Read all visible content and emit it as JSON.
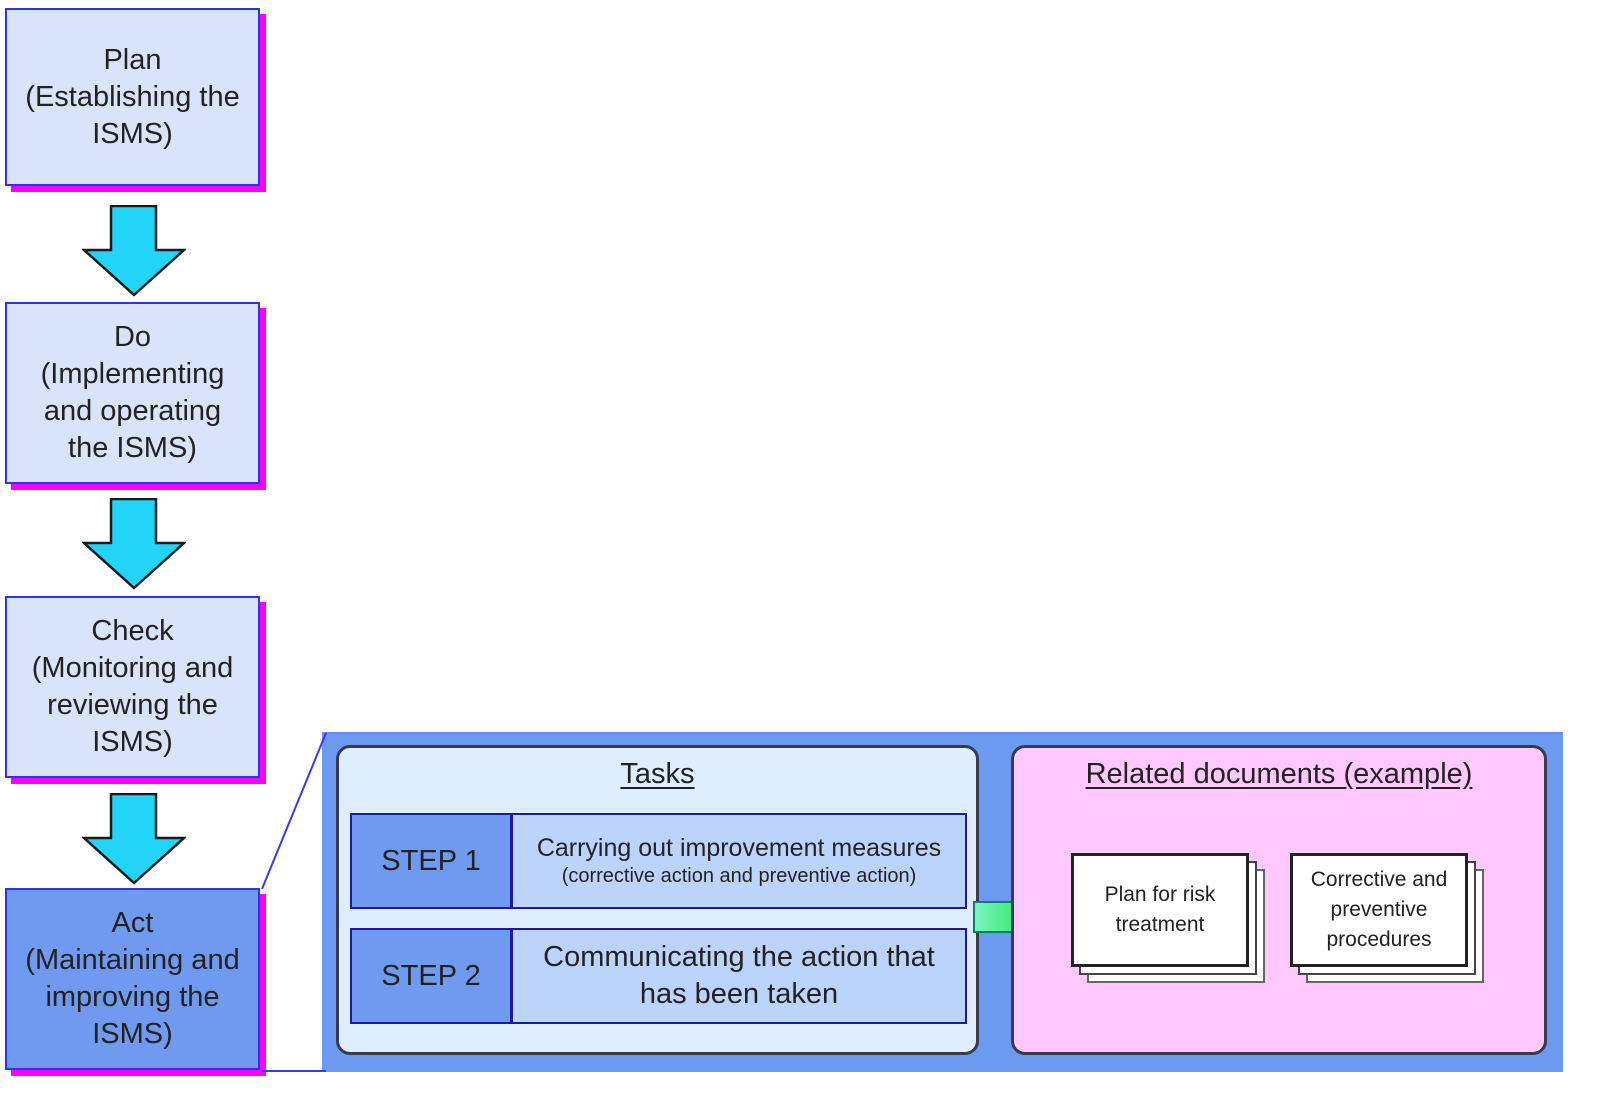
{
  "pdca": [
    {
      "id": "plan",
      "text": "Plan\n(Establishing the\nISMS)",
      "active": false
    },
    {
      "id": "do",
      "text": "Do\n(Implementing\nand operating\nthe ISMS)",
      "active": false
    },
    {
      "id": "check",
      "text": "Check\n(Monitoring and\nreviewing the\nISMS)",
      "active": false
    },
    {
      "id": "act",
      "text": "Act\n(Maintaining and\nimproving the\nISMS)",
      "active": true
    }
  ],
  "tasks": {
    "title": "Tasks",
    "steps": [
      {
        "label": "STEP 1",
        "description": "Carrying out improvement measures",
        "note": "(corrective action and preventive action)"
      },
      {
        "label": "STEP 2",
        "description": "Communicating the action that\nhas been taken"
      }
    ]
  },
  "related_documents": {
    "title": "Related documents (example)",
    "documents": [
      "Plan for risk\ntreatment",
      "Corrective and\npreventive\nprocedures"
    ]
  },
  "colors": {
    "phase_fill": "#d9e4fb",
    "phase_active_fill": "#6f9af0",
    "phase_border": "#2b35e8",
    "phase_shadow": "#ff00ff",
    "flow_arrow": "#22d4f7",
    "panel_fill": "#6b9af0",
    "tasks_fill": "#dfeeff",
    "docs_fill": "#ffc8ff",
    "output_arrow": "#22e87a"
  }
}
